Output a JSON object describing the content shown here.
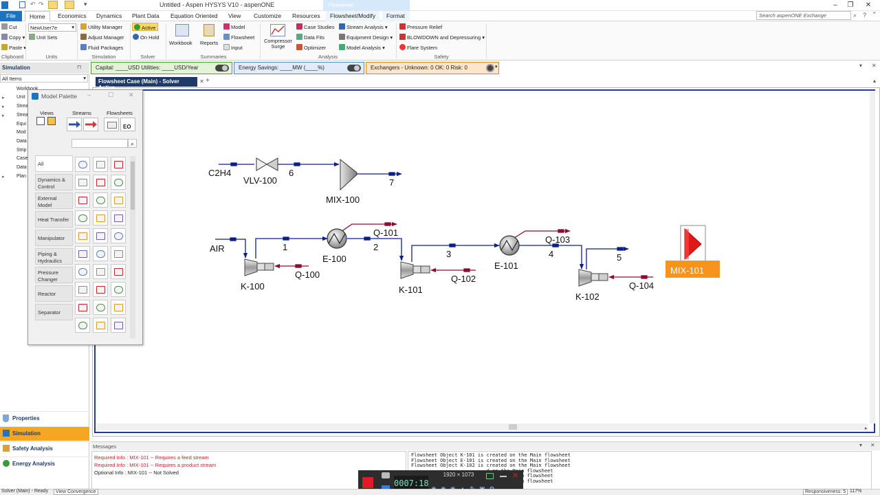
{
  "app": {
    "title": "Untitled - Aspen HYSYS V10 - aspenONE",
    "context_tab": "Flowsheet",
    "search_placeholder": "Search aspenONE Exchange"
  },
  "menu": [
    "File",
    "Home",
    "Economics",
    "Dynamics",
    "Plant Data",
    "Equation Oriented",
    "View",
    "Customize",
    "Resources",
    "Flowsheet/Modify",
    "Format"
  ],
  "ribbon": {
    "clipboard": {
      "cut": "Cut",
      "copy": "Copy",
      "paste": "Paste",
      "group": "Clipboard"
    },
    "units": {
      "unit_set_value": "NewUser7e",
      "unit_sets": "Unit Sets",
      "group": "Units"
    },
    "simulation": {
      "utility_manager": "Utility Manager",
      "adjust_manager": "Adjust Manager",
      "fluid_packages": "Fluid Packages",
      "group": "Simulation"
    },
    "solver": {
      "active": "Active",
      "on_hold": "On Hold",
      "group": "Solver"
    },
    "summaries": {
      "workbook": "Workbook",
      "reports": "Reports",
      "model": "Model",
      "flowsheet": "Flowsheet",
      "input": "Input",
      "group": "Summaries"
    },
    "analysis": {
      "compressor_surge_1": "Compressor",
      "compressor_surge_2": "Surge",
      "case_studies": "Case Studies",
      "data_fits": "Data Fits",
      "optimizer": "Optimizer",
      "stream_analysis": "Stream Analysis",
      "equipment_design": "Equipment Design",
      "model_analysis": "Model Analysis",
      "group": "Analysis"
    },
    "safety": {
      "pressure_relief": "Pressure Relief",
      "blowdown": "BLOWDOWN and Depressuring",
      "flare_system": "Flare System",
      "group": "Safety"
    }
  },
  "left_panel": {
    "header": "Simulation",
    "filter": "All Items",
    "tree": [
      "Workbook",
      "Unit",
      "Strea",
      "Strea",
      "Equi",
      "Mod",
      "Data",
      "Strip",
      "Case",
      "Data",
      "Plan"
    ],
    "nav": [
      "Properties",
      "Simulation",
      "Safety Analysis",
      "Energy Analysis"
    ]
  },
  "status_strips": {
    "capital": "Capital: ____USD  Utilities: ____USD/Year",
    "energy": "Energy Savings: ____MW   (____%)",
    "exchangers": "Exchangers -   Unknown: 0   OK: 0   Risk: 0"
  },
  "flowsheet_tab": "Flowsheet Case (Main) - Solver Active",
  "palette": {
    "title": "Model Palette",
    "sections": [
      "Views",
      "Streams",
      "Flowsheets"
    ],
    "eo_label": "EO",
    "categories": [
      "All",
      "Dynamics & Control",
      "External Model",
      "Heat Transfer",
      "Manipulator",
      "Piping & Hydraulics",
      "Pressure Changer",
      "Reactor",
      "Separator"
    ]
  },
  "flowsheet": {
    "labels": {
      "c2h4": "C2H4",
      "vlv100": "VLV-100",
      "s6": "6",
      "s7": "7",
      "mix100": "MIX-100",
      "air": "AIR",
      "s1": "1",
      "s2": "2",
      "s3": "3",
      "s4": "4",
      "s5": "5",
      "e100": "E-100",
      "e101": "E-101",
      "k100": "K-100",
      "k101": "K-101",
      "k102": "K-102",
      "q100": "Q-100",
      "q101": "Q-101",
      "q102": "Q-102",
      "q103": "Q-103",
      "q104": "Q-104",
      "mix101": "MIX-101"
    }
  },
  "messages": {
    "header": "Messages",
    "left": [
      {
        "text": "Required Info : MIX-101 -- Requires a feed stream",
        "color": "#c0282e"
      },
      {
        "text": "Required Info : MIX-101 -- Requires a product stream",
        "color": "#c0282e"
      },
      {
        "text": "Optional Info : MIX-101 -- Not Solved",
        "color": "#222222"
      }
    ],
    "right": "Flowsheet Object K-101 is created on the Main flowsheet\nFlowsheet Object E-101 is created on the Main flowsheet\nFlowsheet Object K-102 is created on the Main flowsheet\n                          d on the Main flowsheet\n                          d on the Main flowsheet\n                          d on the Main flowsheet"
  },
  "recorder": {
    "time": "0007:18",
    "resolution": "1920 × 1073"
  },
  "statusbar": {
    "solver": "Solver (Main) - Ready",
    "view": "View Convergence",
    "responsiveness": "Responsiveness: 5",
    "zoom": "117%"
  },
  "colors": {
    "accent": "#1e73be",
    "material_stream": "#0b1f8a",
    "energy_stream": "#8b0c2e",
    "selected_orange": "#f7941d",
    "mixer_red": "#e11818"
  }
}
